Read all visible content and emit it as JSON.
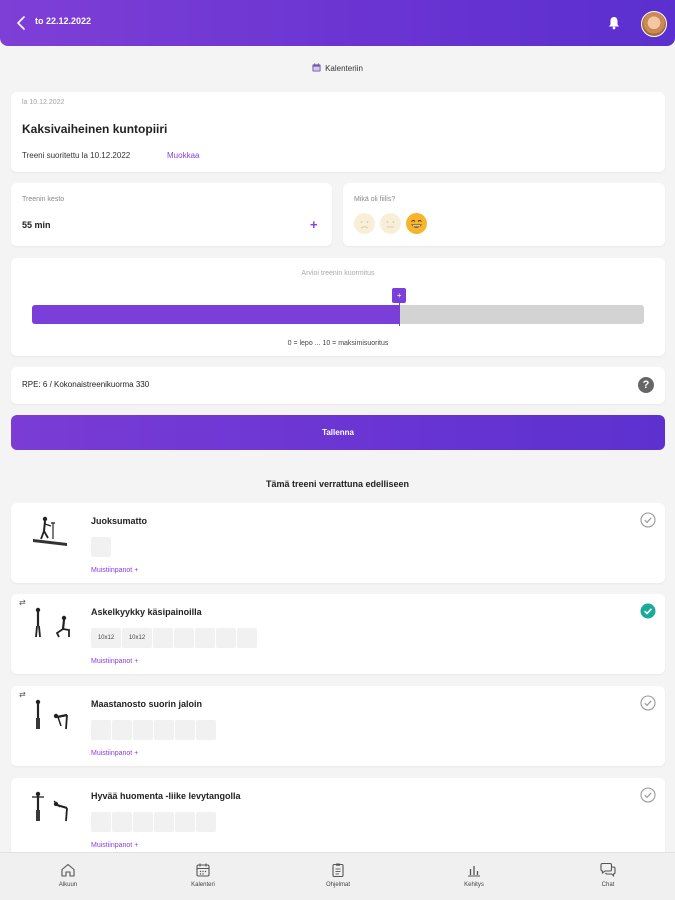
{
  "header": {
    "date_title": "to 22.12.2022"
  },
  "calendar_link": "Kalenteriin",
  "workout": {
    "date": "la 10.12.2022",
    "title": "Kaksivaiheinen kuntopiiri",
    "completed_text": "Treeni suoritettu la 10.12.2022",
    "edit_label": "Muokkaa"
  },
  "duration": {
    "label": "Treenin kesto",
    "value": "55 min",
    "add_symbol": "+"
  },
  "feeling": {
    "label": "Mikä oli fiilis?",
    "selected_index": 2
  },
  "rpe": {
    "label": "Arvioi treenin kuormitus",
    "value": 6,
    "max": 10,
    "handle_symbol": "+",
    "scale_text": "0 = lepo ... 10 = maksimisuoritus"
  },
  "load_summary": {
    "text": "RPE: 6 / Kokonaistreenikuorma 330",
    "help_symbol": "?"
  },
  "save_label": "Tallenna",
  "comparison_title": "Tämä treeni verrattuna edelliseen",
  "exercises": [
    {
      "name": "Juoksumatto",
      "sets": [
        ""
      ],
      "notes": "Muistiinpanot +",
      "completed": false,
      "swap": ""
    },
    {
      "name": "Askelkyykky käsipainoilla",
      "sets": [
        "10x12",
        "10x12",
        "",
        "",
        "",
        "",
        ""
      ],
      "notes": "Muistiinpanot +",
      "completed": true,
      "swap": "⇄"
    },
    {
      "name": "Maastanosto suorin jaloin",
      "sets": [
        "",
        "",
        "",
        "",
        "",
        ""
      ],
      "notes": "Muistiinpanot +",
      "completed": false,
      "swap": "⇄"
    },
    {
      "name": "Hyvää huomenta -liike levytangolla",
      "sets": [
        "",
        "",
        "",
        "",
        "",
        ""
      ],
      "notes": "Muistiinpanot +",
      "completed": false,
      "swap": ""
    }
  ],
  "tabs": [
    {
      "label": "Alkuun",
      "icon": "home-icon"
    },
    {
      "label": "Kalenteri",
      "icon": "calendar-icon"
    },
    {
      "label": "Ohjelmat",
      "icon": "clipboard-icon"
    },
    {
      "label": "Kehitys",
      "icon": "chart-icon"
    },
    {
      "label": "Chat",
      "icon": "chat-icon"
    }
  ],
  "colors": {
    "accent": "#7b3fd9",
    "success": "#1aa99a"
  }
}
